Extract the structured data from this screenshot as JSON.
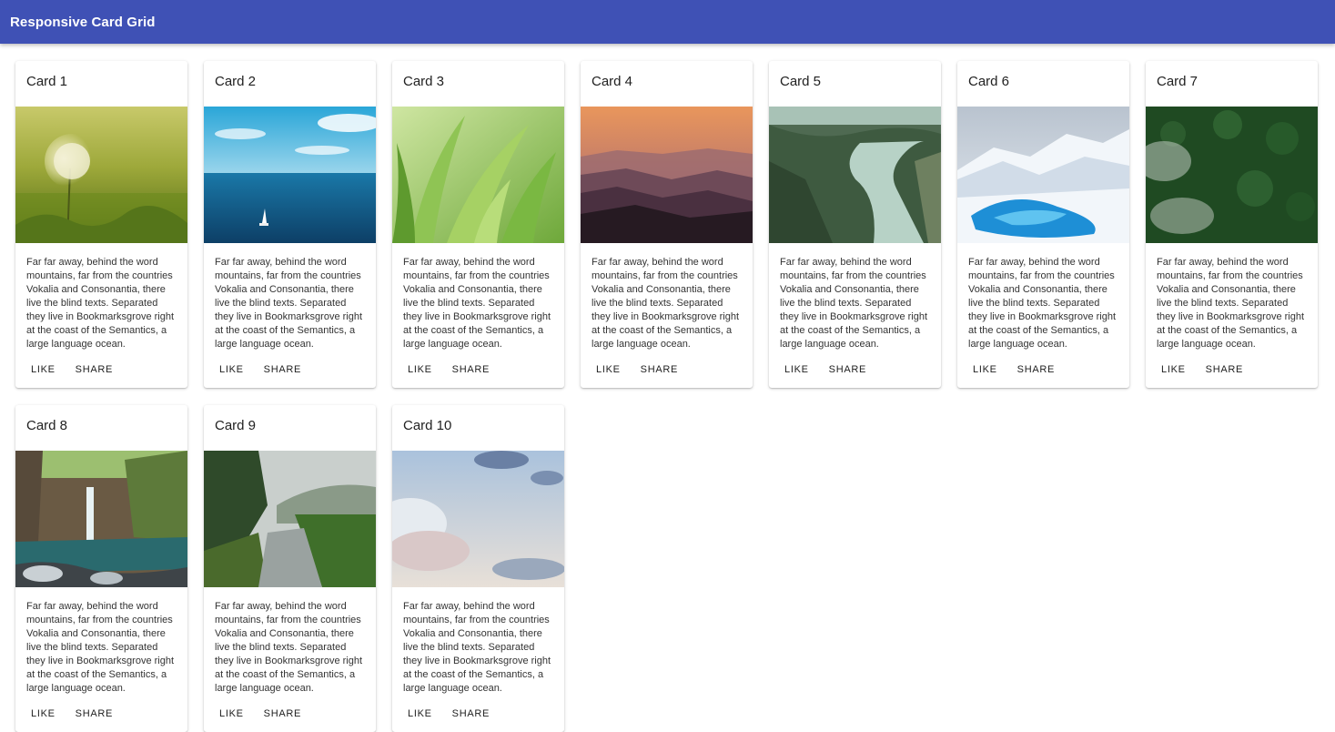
{
  "app_bar": {
    "title": "Responsive Card Grid"
  },
  "cards": [
    {
      "title": "Card 1",
      "text": "Far far away, behind the word mountains, far from the countries Vokalia and Consonantia, there live the blind texts. Separated they live in Bookmarksgrove right at the coast of the Semantics, a large language ocean.",
      "like_label": "LIKE",
      "share_label": "SHARE",
      "image": "dandelion-meadow"
    },
    {
      "title": "Card 2",
      "text": "Far far away, behind the word mountains, far from the countries Vokalia and Consonantia, there live the blind texts. Separated they live in Bookmarksgrove right at the coast of the Semantics, a large language ocean.",
      "like_label": "LIKE",
      "share_label": "SHARE",
      "image": "ocean-sailboat"
    },
    {
      "title": "Card 3",
      "text": "Far far away, behind the word mountains, far from the countries Vokalia and Consonantia, there live the blind texts. Separated they live in Bookmarksgrove right at the coast of the Semantics, a large language ocean.",
      "like_label": "LIKE",
      "share_label": "SHARE",
      "image": "grass-closeup"
    },
    {
      "title": "Card 4",
      "text": "Far far away, behind the word mountains, far from the countries Vokalia and Consonantia, there live the blind texts. Separated they live in Bookmarksgrove right at the coast of the Semantics, a large language ocean.",
      "like_label": "LIKE",
      "share_label": "SHARE",
      "image": "mountain-sunset"
    },
    {
      "title": "Card 5",
      "text": "Far far away, behind the word mountains, far from the countries Vokalia and Consonantia, there live the blind texts. Separated they live in Bookmarksgrove right at the coast of the Semantics, a large language ocean.",
      "like_label": "LIKE",
      "share_label": "SHARE",
      "image": "river-valley"
    },
    {
      "title": "Card 6",
      "text": "Far far away, behind the word mountains, far from the countries Vokalia and Consonantia, there live the blind texts. Separated they live in Bookmarksgrove right at the coast of the Semantics, a large language ocean.",
      "like_label": "LIKE",
      "share_label": "SHARE",
      "image": "glacier-ice"
    },
    {
      "title": "Card 7",
      "text": "Far far away, behind the word mountains, far from the countries Vokalia and Consonantia, there live the blind texts. Separated they live in Bookmarksgrove right at the coast of the Semantics, a large language ocean.",
      "like_label": "LIKE",
      "share_label": "SHARE",
      "image": "misty-forest"
    },
    {
      "title": "Card 8",
      "text": "Far far away, behind the word mountains, far from the countries Vokalia and Consonantia, there live the blind texts. Separated they live in Bookmarksgrove right at the coast of the Semantics, a large language ocean.",
      "like_label": "LIKE",
      "share_label": "SHARE",
      "image": "waterfall"
    },
    {
      "title": "Card 9",
      "text": "Far far away, behind the word mountains, far from the countries Vokalia and Consonantia, there live the blind texts. Separated they live in Bookmarksgrove right at the coast of the Semantics, a large language ocean.",
      "like_label": "LIKE",
      "share_label": "SHARE",
      "image": "country-road"
    },
    {
      "title": "Card 10",
      "text": "Far far away, behind the word mountains, far from the countries Vokalia and Consonantia, there live the blind texts. Separated they live in Bookmarksgrove right at the coast of the Semantics, a large language ocean.",
      "like_label": "LIKE",
      "share_label": "SHARE",
      "image": "cloudy-sky"
    }
  ],
  "colors": {
    "app_bar": "#3f51b5",
    "app_bar_text": "#ffffff"
  }
}
